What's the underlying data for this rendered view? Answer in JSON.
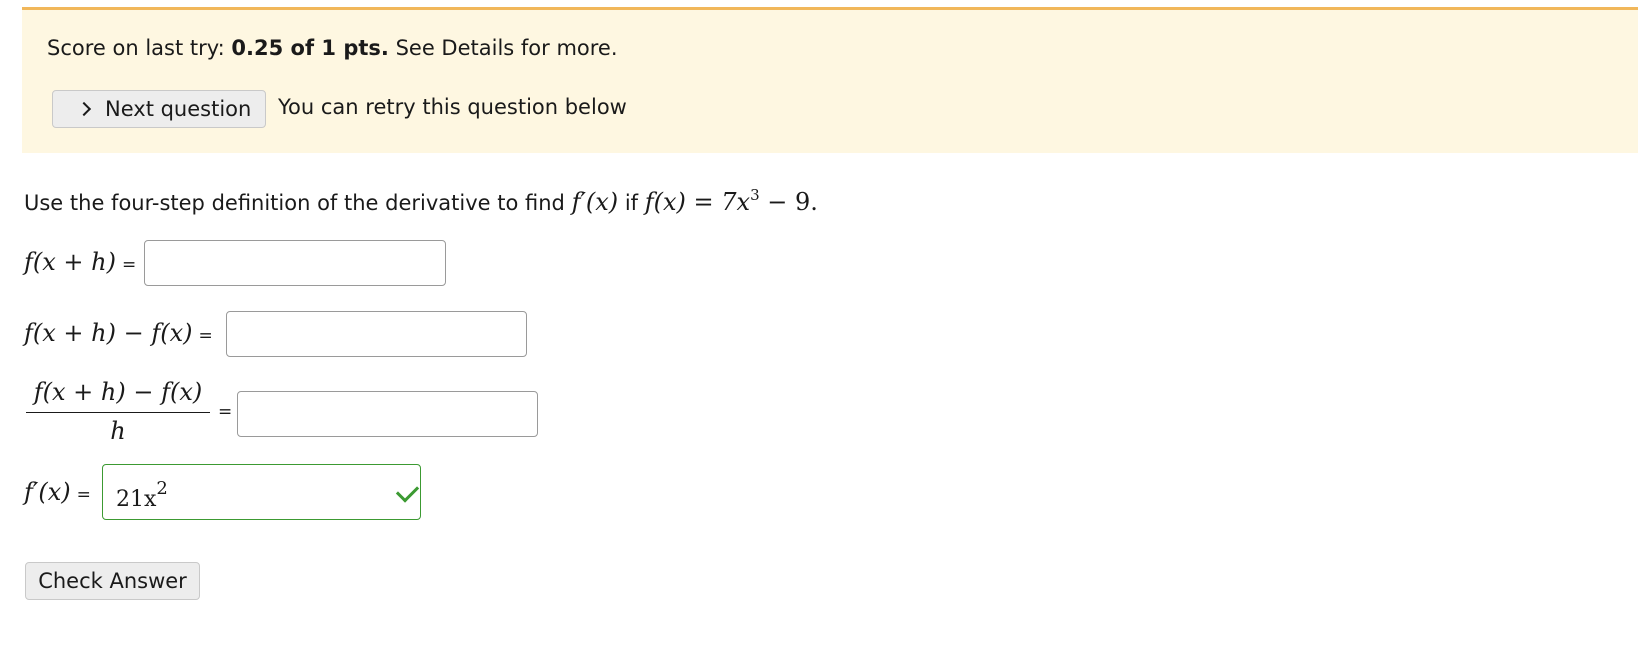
{
  "banner": {
    "score_prefix": "Score on last try: ",
    "score_value": "0.25 of 1 pts.",
    "score_suffix": " See Details for more.",
    "next_button_label": "Next question",
    "retry_note": "You can retry this question below",
    "accent_color": "#f1b75a",
    "background_color": "#fef7e1"
  },
  "question": {
    "prompt_text": "Use the four-step definition of the derivative to find ",
    "prompt_mid": " if ",
    "prompt_fprime": "f′(x)",
    "prompt_func_lhs": "f(x) = 7x",
    "prompt_func_exp": "3",
    "prompt_func_tail": " − 9."
  },
  "steps": [
    {
      "label": "f(x + h)",
      "equals": "=",
      "value": ""
    },
    {
      "label": "f(x + h) − f(x)",
      "equals": "=",
      "value": ""
    },
    {
      "label_numerator": "f(x + h) − f(x)",
      "label_denominator": "h",
      "equals": "=",
      "value": ""
    },
    {
      "label": "f′(x)",
      "equals": "=",
      "value_base": "21x",
      "value_exp": "2",
      "status": "correct",
      "status_icon": "checkmark-icon"
    }
  ],
  "actions": {
    "check_answer_label": "Check Answer"
  },
  "colors": {
    "correct": "#3c9a32",
    "button_bg": "#ededed"
  }
}
